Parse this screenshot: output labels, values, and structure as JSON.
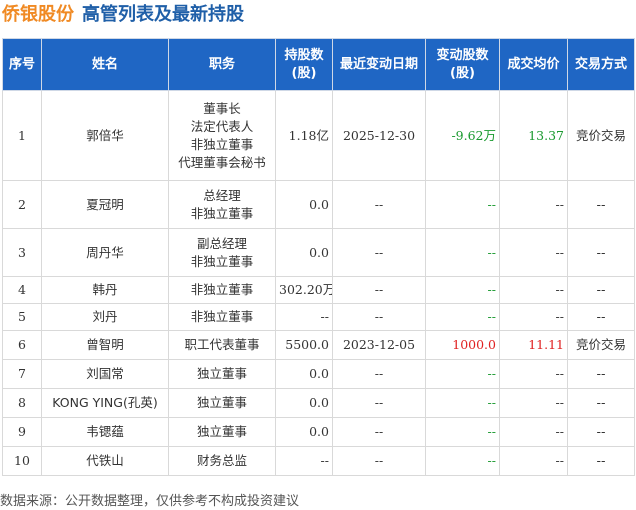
{
  "header": {
    "company": "侨银股份",
    "subtitle": "高管列表及最新持股"
  },
  "columns": [
    "序号",
    "姓名",
    "职务",
    "持股数\n(股)",
    "最近变动日期",
    "变动股数\n(股)",
    "成交均价",
    "交易方式"
  ],
  "rows": [
    {
      "no": "1",
      "name": "郭倍华",
      "roles": [
        "董事长",
        "法定代表人",
        "非独立董事",
        "代理董事会秘书"
      ],
      "shares": "1.18亿",
      "date": "2025-12-30",
      "change": "-9.62万",
      "price": "13.37",
      "method": "竞价交易"
    },
    {
      "no": "2",
      "name": "夏冠明",
      "roles": [
        "总经理",
        "非独立董事"
      ],
      "shares": "0.0",
      "date": "--",
      "change": "--",
      "price": "--",
      "method": "--"
    },
    {
      "no": "3",
      "name": "周丹华",
      "roles": [
        "副总经理",
        "非独立董事"
      ],
      "shares": "0.0",
      "date": "--",
      "change": "--",
      "price": "--",
      "method": "--"
    },
    {
      "no": "4",
      "name": "韩丹",
      "roles": [
        "非独立董事"
      ],
      "shares": "302.20万",
      "date": "--",
      "change": "--",
      "price": "--",
      "method": "--"
    },
    {
      "no": "5",
      "name": "刘丹",
      "roles": [
        "非独立董事"
      ],
      "shares": "--",
      "date": "--",
      "change": "--",
      "price": "--",
      "method": "--"
    },
    {
      "no": "6",
      "name": "曾智明",
      "roles": [
        "职工代表董事"
      ],
      "shares": "5500.0",
      "date": "2023-12-05",
      "change": "1000.0",
      "price": "11.11",
      "method": "竞价交易"
    },
    {
      "no": "7",
      "name": "刘国常",
      "roles": [
        "独立董事"
      ],
      "shares": "0.0",
      "date": "--",
      "change": "--",
      "price": "--",
      "method": "--"
    },
    {
      "no": "8",
      "name": "KONG YING(孔英)",
      "roles": [
        "独立董事"
      ],
      "shares": "0.0",
      "date": "--",
      "change": "--",
      "price": "--",
      "method": "--"
    },
    {
      "no": "9",
      "name": "韦锶蕴",
      "roles": [
        "独立董事"
      ],
      "shares": "0.0",
      "date": "--",
      "change": "--",
      "price": "--",
      "method": "--"
    },
    {
      "no": "10",
      "name": "代铁山",
      "roles": [
        "财务总监"
      ],
      "shares": "--",
      "date": "--",
      "change": "--",
      "price": "--",
      "method": "--"
    }
  ],
  "footer": "数据来源：公开数据整理，仅供参考不构成投资建议",
  "colors": {
    "header_bg": "#1f66c4",
    "company": "#f08a24",
    "subtitle": "#1f5fa8",
    "negative": "#1a9a2f",
    "positive": "#e02020"
  }
}
